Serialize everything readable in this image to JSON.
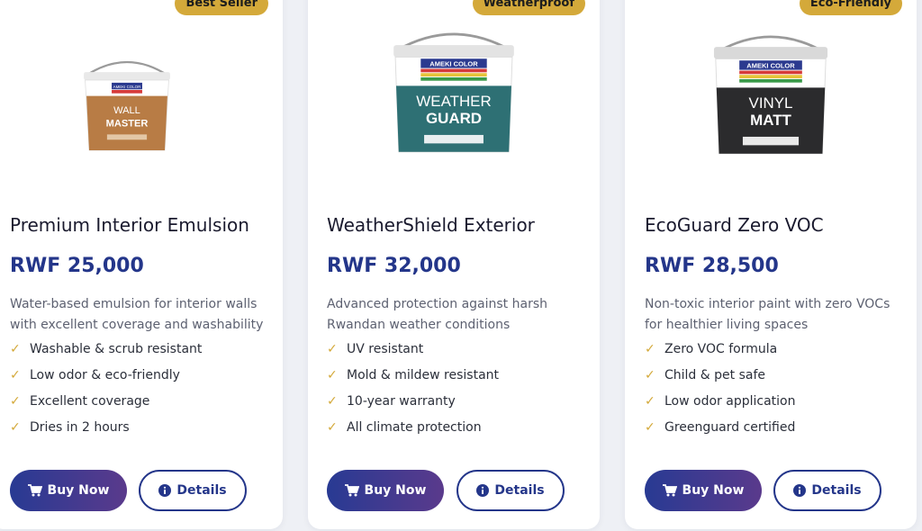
{
  "colors": {
    "accent": "#d4a93a",
    "brand": "#24368a",
    "buy_gradient_start": "#283a93",
    "buy_gradient_end": "#5a3a8c"
  },
  "buttons": {
    "buy_label": "Buy Now",
    "details_label": "Details",
    "buy_icon": "cart-icon",
    "details_icon": "info-circle-icon"
  },
  "products": [
    {
      "badge": "Best Seller",
      "image": {
        "brand": "AMEKI COLOR",
        "line1": "WALL",
        "line2": "MASTER",
        "color": "#b87c45"
      },
      "title": "Premium Interior Emulsion",
      "price": "RWF 25,000",
      "description": "Water-based emulsion for interior walls with excellent coverage and washability",
      "features": [
        "Washable & scrub resistant",
        "Low odor & eco-friendly",
        "Excellent coverage",
        "Dries in 2 hours"
      ]
    },
    {
      "badge": "Weatherproof",
      "image": {
        "brand": "AMEKI COLOR",
        "line1": "WEATHER",
        "line2": "GUARD",
        "color": "#2e7074"
      },
      "title": "WeatherShield Exterior",
      "price": "RWF 32,000",
      "description": "Advanced protection against harsh Rwandan weather conditions",
      "features": [
        "UV resistant",
        "Mold & mildew resistant",
        "10-year warranty",
        "All climate protection"
      ]
    },
    {
      "badge": "Eco-Friendly",
      "image": {
        "brand": "AMEKI COLOR",
        "line1": "VINYL",
        "line2": "MATT",
        "color": "#2b2b2d"
      },
      "title": "EcoGuard Zero VOC",
      "price": "RWF 28,500",
      "description": "Non-toxic interior paint with zero VOCs for healthier living spaces",
      "features": [
        "Zero VOC formula",
        "Child & pet safe",
        "Low odor application",
        "Greenguard certified"
      ]
    }
  ]
}
